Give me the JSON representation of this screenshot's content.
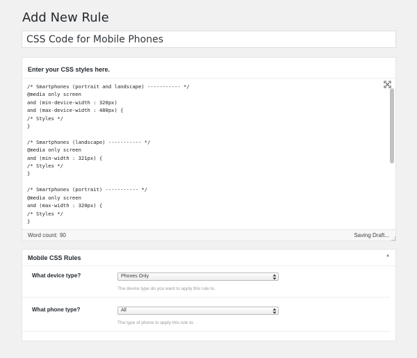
{
  "page": {
    "title": "Add New Rule"
  },
  "rule_title": {
    "value": "CSS Code for Mobile Phones"
  },
  "editor": {
    "heading": "Enter your CSS styles here.",
    "code": "/* Smartphones (portrait and landscape) ----------- */\n@media only screen\nand (min-device-width : 320px)\nand (max-device-width : 480px) {\n/* Styles */\n}\n\n/* Smartphones (landscape) ----------- */\n@media only screen\nand (min-width : 321px) {\n/* Styles */\n}\n\n/* Smartphones (portrait) ----------- */\n@media only screen\nand (max-width : 320px) {\n/* Styles */\n}",
    "word_count_label": "Word count:",
    "word_count": "90",
    "save_status": "Saving Draft..."
  },
  "mobile_css_rules": {
    "title": "Mobile CSS Rules",
    "device_type": {
      "label": "What device type?",
      "selected": "Phones Only",
      "description": "The device type do you want to apply this rule to."
    },
    "phone_type": {
      "label": "What phone type?",
      "selected": "All",
      "description": "The type of phone to apply this rule to."
    }
  },
  "icons": {
    "fullscreen": "fullscreen-icon",
    "collapse": "collapse-arrow-icon",
    "select_arrows": "select-arrows-icon"
  },
  "colors": {
    "background": "#f1f1f1",
    "panel": "#ffffff",
    "border": "#e5e5e5"
  }
}
